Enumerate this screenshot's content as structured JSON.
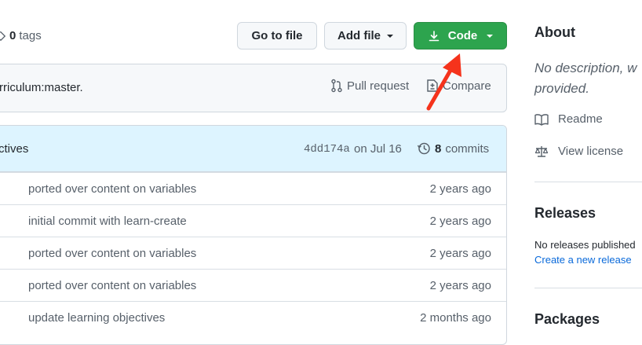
{
  "top": {
    "tags_count": "0",
    "tags_label": "tags",
    "go_to_file": "Go to file",
    "add_file": "Add file",
    "code": "Code"
  },
  "compare_bar": {
    "text": "rriculum:master.",
    "pull_request": "Pull request",
    "compare": "Compare"
  },
  "latest_commit": {
    "message": "ctives",
    "sha": "4dd174a",
    "date": "on Jul 16",
    "commit_count": "8",
    "commit_label": "commits"
  },
  "files": [
    {
      "message": "ported over content on variables",
      "time": "2 years ago"
    },
    {
      "message": "initial commit with learn-create",
      "time": "2 years ago"
    },
    {
      "message": "ported over content on variables",
      "time": "2 years ago"
    },
    {
      "message": "ported over content on variables",
      "time": "2 years ago"
    },
    {
      "message": "update learning objectives",
      "time": "2 months ago"
    }
  ],
  "sidebar": {
    "about_title": "About",
    "description_line1": "No description, w",
    "description_line2": "provided.",
    "readme": "Readme",
    "license": "View license",
    "releases_title": "Releases",
    "no_releases": "No releases published",
    "create_release": "Create a new release",
    "packages_title": "Packages"
  },
  "colors": {
    "code_button": "#2da44e",
    "link": "#0969da",
    "annotation_arrow": "#f5331c"
  }
}
